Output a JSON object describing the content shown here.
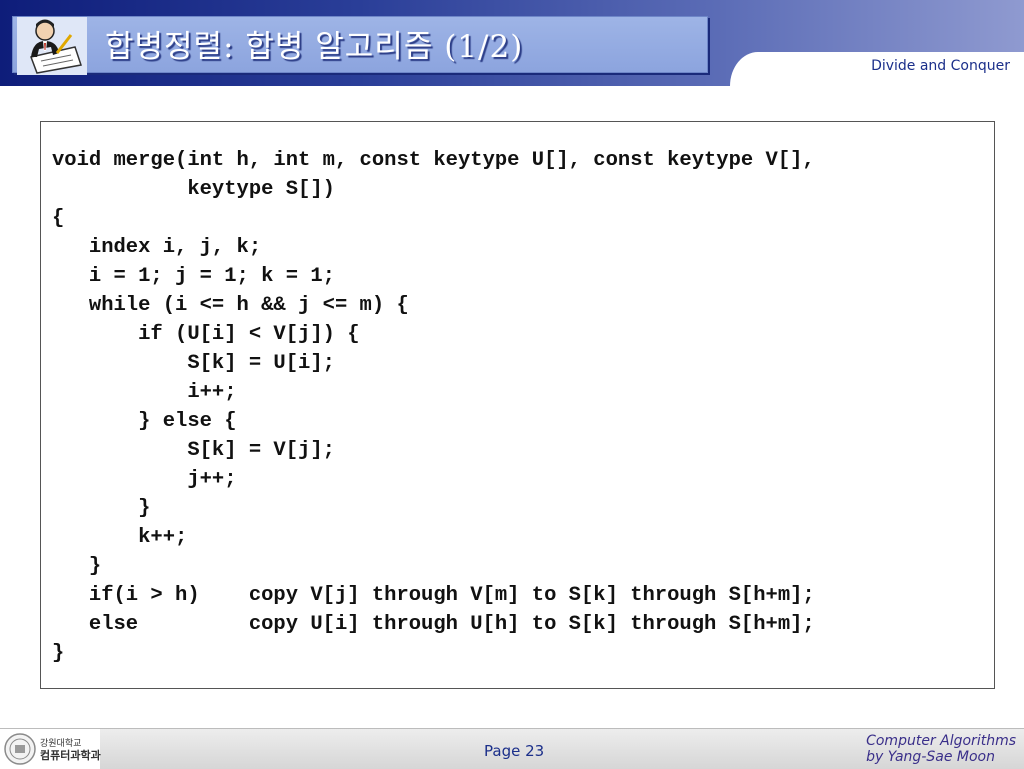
{
  "header": {
    "title": "합병정렬: 합병 알고리즘 (1/2)",
    "section_tab": "Divide and Conquer",
    "logo_icon": "professor-with-pen-icon"
  },
  "code": {
    "lines": [
      "void merge(int h, int m, const keytype U[], const keytype V[],",
      "           keytype S[])",
      "{",
      "   index i, j, k;",
      "   i = 1; j = 1; k = 1;",
      "   while (i <= h && j <= m) {",
      "       if (U[i] < V[j]) {",
      "           S[k] = U[i];",
      "           i++;",
      "       } else {",
      "           S[k] = V[j];",
      "           j++;",
      "       }",
      "       k++;",
      "   }",
      "   if(i > h)    copy V[j] through V[m] to S[k] through S[h+m];",
      "   else         copy U[i] through U[h] to S[k] through S[h+m];",
      "}"
    ]
  },
  "footer": {
    "dept_line1": "강원대학교",
    "dept_line2": "컴퓨터과학과",
    "page": "Page 23",
    "credit_line1": "Computer Algorithms",
    "credit_line2": "by Yang-Sae Moon",
    "seal_icon": "university-seal-icon"
  },
  "colors": {
    "header_dark": "#0e1d7a",
    "title_box": "#9eb4e6",
    "accent_text": "#1b2f8a"
  }
}
